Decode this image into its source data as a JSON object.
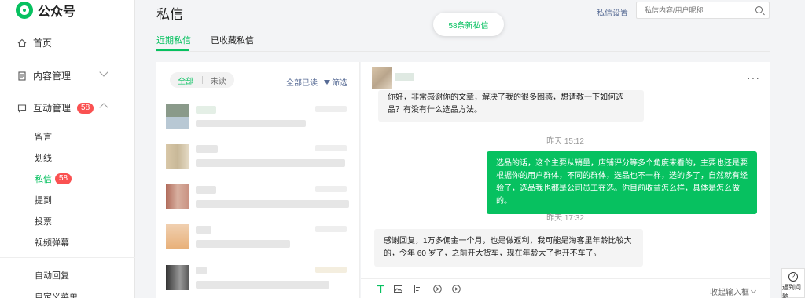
{
  "brand": {
    "name": "公众号",
    "accent": "#07c160"
  },
  "sidebar": {
    "items": [
      {
        "label": "首页",
        "icon": "home-icon"
      },
      {
        "label": "内容管理",
        "icon": "document-icon"
      },
      {
        "label": "互动管理",
        "icon": "chat-icon",
        "badge": "58"
      }
    ],
    "sub_items": [
      "留言",
      "划线",
      "私信",
      "提到",
      "投票",
      "视频弹幕"
    ],
    "active_sub_badge": "58",
    "more_items": [
      "自动回复",
      "自定义菜单"
    ]
  },
  "header": {
    "title": "私信",
    "settings_label": "私信设置",
    "search_placeholder": "私信内容/用户昵称",
    "new_messages": "58条新私信"
  },
  "tabs": [
    "近期私信",
    "已收藏私信"
  ],
  "list": {
    "filter_all": "全部",
    "filter_unread": "未读",
    "mark_all_read": "全部已读",
    "filter_label": "筛选",
    "avatar_colors": [
      [
        "#8a9a8a",
        "#b8c8d4"
      ],
      [
        "#d9c8a8",
        "#e6dcc8"
      ],
      [
        "#b06a5a",
        "#d8b0a0"
      ],
      [
        "#e8b078",
        "#f0d0b0"
      ],
      [
        "#333333",
        "#999999"
      ]
    ]
  },
  "chat": {
    "more": "···",
    "messages": [
      {
        "side": "left",
        "text": "你好，非常感谢你的文章，解决了我的很多困惑，想请教一下如何选品？有没有什么选品方法。"
      },
      {
        "type": "time",
        "text": "昨天 15:12"
      },
      {
        "side": "right",
        "text": "选品的话，这个主要从销量，店铺评分等多个角度来看的，主要也还是要根据你的用户群体，不同的群体，选品也不一样，选的多了，自然就有经验了，选品我也都是公司员工在选。你目前收益怎么样，具体是怎么做的。"
      },
      {
        "type": "time",
        "text": "昨天 17:32"
      },
      {
        "side": "left",
        "text": "感谢回复，1万多佣金一个月，也是做返利，我可能是淘客里年龄比较大的，今年 60 岁了，之前开大货车，现在年龄大了也开不车了。"
      }
    ],
    "collapse_label": "收起输入框"
  },
  "help": {
    "label": "遇到问题"
  }
}
